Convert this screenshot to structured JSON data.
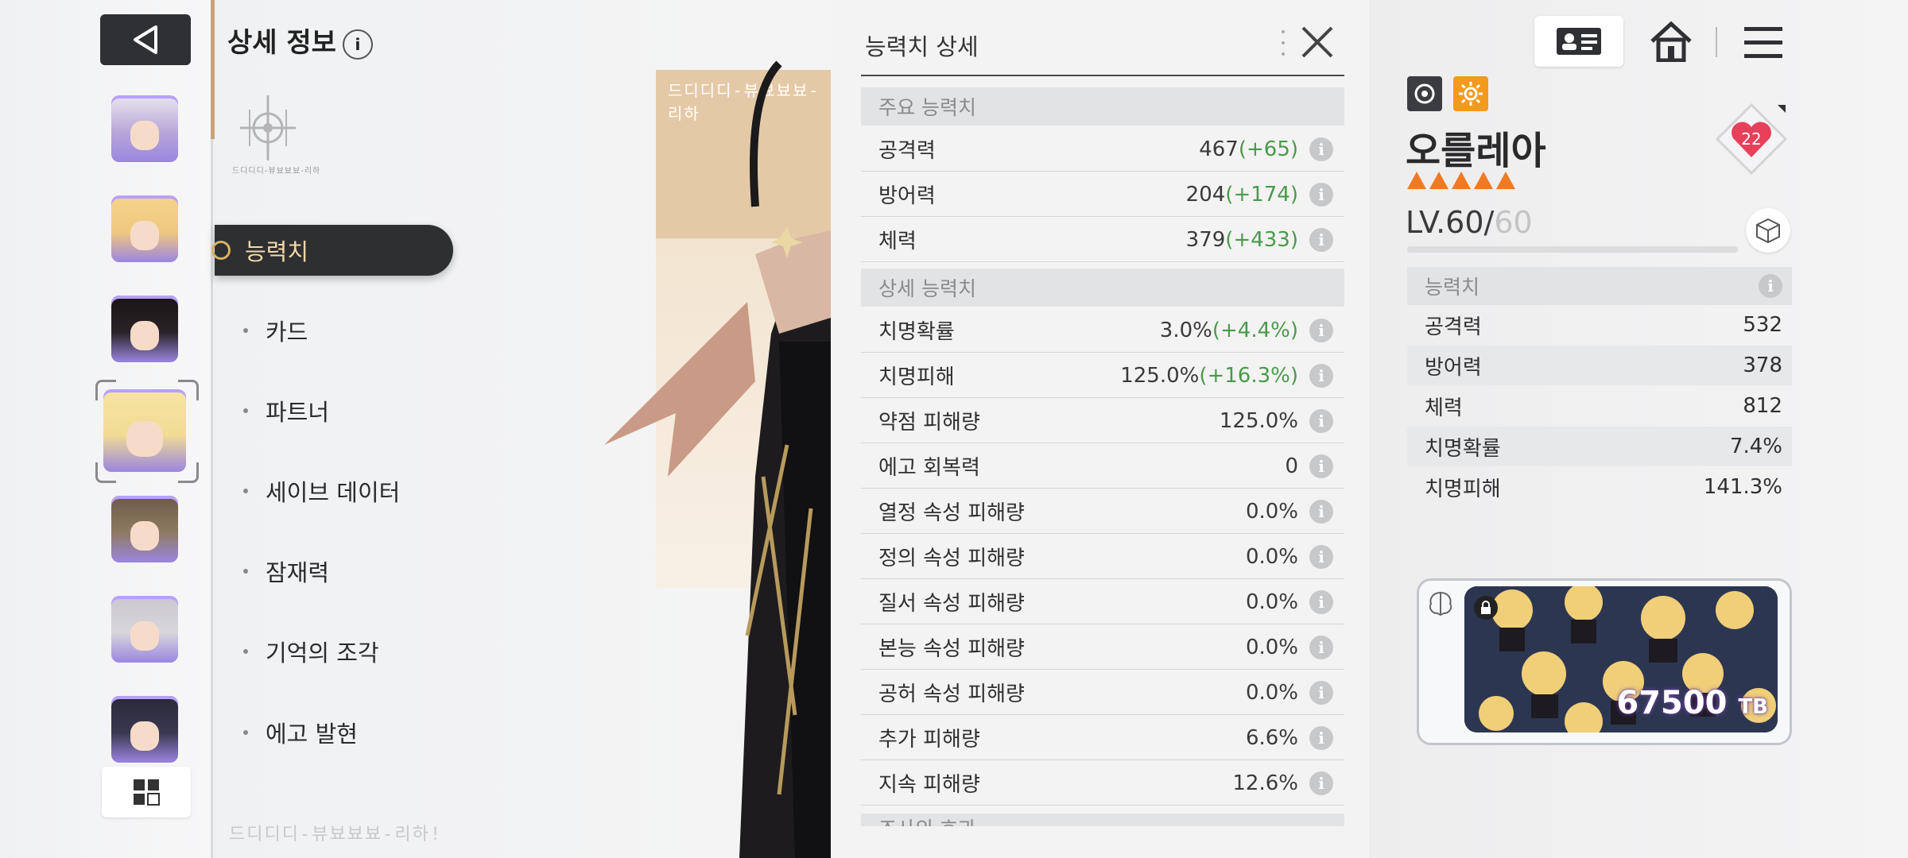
{
  "sidebar": {
    "back_label": "",
    "avatars": [
      {
        "name": "avatar-1",
        "bg": "#b9a7d8",
        "hair": "#e8e6f0"
      },
      {
        "name": "avatar-2",
        "bg": "#f0c880",
        "hair": "#f4d48a"
      },
      {
        "name": "avatar-3",
        "bg": "#2a2226",
        "hair": "#1a1416"
      },
      {
        "name": "avatar-4",
        "bg": "#f2dc94",
        "hair": "#f6e4a4"
      },
      {
        "name": "avatar-5",
        "bg": "#8e7a62",
        "hair": "#6d5a46"
      },
      {
        "name": "avatar-6",
        "bg": "#d8d6dc",
        "hair": "#c9c6cf"
      },
      {
        "name": "avatar-7",
        "bg": "#3a3850",
        "hair": "#2a2838"
      }
    ]
  },
  "menu": {
    "title": "상세 정보",
    "emblem_text": "드디디디-뷰뵤뵤뵤-리하",
    "items": [
      {
        "label": "능력치",
        "active": true
      },
      {
        "label": "카드",
        "active": false
      },
      {
        "label": "파트너",
        "active": false
      },
      {
        "label": "세이브 데이터",
        "active": false
      },
      {
        "label": "잠재력",
        "active": false
      },
      {
        "label": "기억의 조각",
        "active": false
      },
      {
        "label": "에고 발현",
        "active": false
      }
    ],
    "bottom_code": "드디디디-뷰뵤뵤뵤-리하!"
  },
  "art": {
    "code": "드디디디-뷰뵤뵤뵤-리하"
  },
  "stats_panel": {
    "title": "능력치 상세",
    "main_section": "주요 능력치",
    "main_rows": [
      {
        "label": "공격력",
        "value": "467",
        "bonus": "(+65)"
      },
      {
        "label": "방어력",
        "value": "204",
        "bonus": "(+174)"
      },
      {
        "label": "체력",
        "value": "379",
        "bonus": "(+433)"
      }
    ],
    "detail_section": "상세 능력치",
    "detail_rows": [
      {
        "label": "치명확률",
        "value": "3.0%",
        "bonus": "(+4.4%)"
      },
      {
        "label": "치명피해",
        "value": "125.0%",
        "bonus": "(+16.3%)"
      },
      {
        "label": "약점 피해량",
        "value": "125.0%",
        "bonus": ""
      },
      {
        "label": "에고 회복력",
        "value": "0",
        "bonus": ""
      },
      {
        "label": "열정 속성 피해량",
        "value": "0.0%",
        "bonus": ""
      },
      {
        "label": "정의 속성 피해량",
        "value": "0.0%",
        "bonus": ""
      },
      {
        "label": "질서 속성 피해량",
        "value": "0.0%",
        "bonus": ""
      },
      {
        "label": "본능 속성 피해량",
        "value": "0.0%",
        "bonus": ""
      },
      {
        "label": "공허 속성 피해량",
        "value": "0.0%",
        "bonus": ""
      },
      {
        "label": "추가 피해량",
        "value": "6.6%",
        "bonus": ""
      },
      {
        "label": "지속 피해량",
        "value": "12.6%",
        "bonus": ""
      }
    ],
    "next_section": "조사의 효과"
  },
  "character": {
    "name": "오를레아",
    "star_count": 5,
    "level": "LV.60/",
    "level_max": "60",
    "affection": "22",
    "summary_title": "능력치",
    "summary": [
      {
        "label": "공격력",
        "value": "532"
      },
      {
        "label": "방어력",
        "value": "378"
      },
      {
        "label": "체력",
        "value": "812"
      },
      {
        "label": "치명확률",
        "value": "7.4%"
      },
      {
        "label": "치명피해",
        "value": "141.3%"
      }
    ],
    "tb_value": "67500",
    "tb_unit": "TB"
  },
  "colors": {
    "accent": "#f07a24",
    "bonus": "#4a9a4a",
    "dark": "#2e2f31",
    "gold": "#d9b36a"
  }
}
